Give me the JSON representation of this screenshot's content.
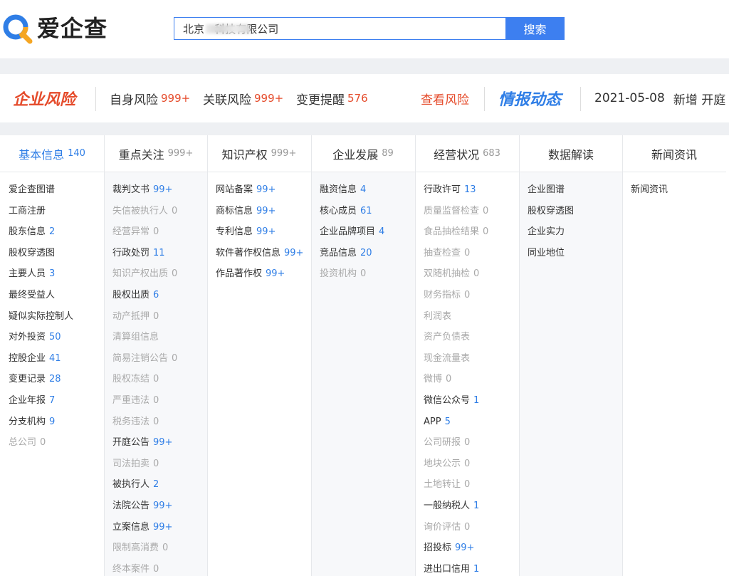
{
  "brand": {
    "name": "爱企查",
    "logo_icon": "magnifier-logo-icon",
    "colors": {
      "blue": "#2f7ee6",
      "orange": "#f5a623"
    }
  },
  "search": {
    "value": "北京   科技有限公司",
    "button_label": "搜索"
  },
  "risk_bar": {
    "banner": "企业风险",
    "items": [
      {
        "label": "自身风险",
        "count": "999+"
      },
      {
        "label": "关联风险",
        "count": "999+"
      },
      {
        "label": "变更提醒",
        "count": "576"
      }
    ],
    "check_label": "查看风险",
    "dynamic_banner": "情报动态",
    "dynamic_date": "2021-05-08",
    "dynamic_text": "新增 开庭"
  },
  "columns": [
    {
      "title": "基本信息",
      "count": "140",
      "items": [
        {
          "label": "爱企查图谱",
          "count": ""
        },
        {
          "label": "工商注册",
          "count": ""
        },
        {
          "label": "股东信息",
          "count": "2"
        },
        {
          "label": "股权穿透图",
          "count": ""
        },
        {
          "label": "主要人员",
          "count": "3"
        },
        {
          "label": "最终受益人",
          "count": ""
        },
        {
          "label": "疑似实际控制人",
          "count": ""
        },
        {
          "label": "对外投资",
          "count": "50"
        },
        {
          "label": "控股企业",
          "count": "41"
        },
        {
          "label": "变更记录",
          "count": "28"
        },
        {
          "label": "企业年报",
          "count": "7"
        },
        {
          "label": "分支机构",
          "count": "9"
        },
        {
          "label": "总公司",
          "count": "0"
        }
      ]
    },
    {
      "title": "重点关注",
      "count": "999+",
      "items": [
        {
          "label": "裁判文书",
          "count": "99+"
        },
        {
          "label": "失信被执行人",
          "count": "0"
        },
        {
          "label": "经营异常",
          "count": "0"
        },
        {
          "label": "行政处罚",
          "count": "11"
        },
        {
          "label": "知识产权出质",
          "count": "0"
        },
        {
          "label": "股权出质",
          "count": "6"
        },
        {
          "label": "动产抵押",
          "count": "0"
        },
        {
          "label": "清算组信息",
          "count": ""
        },
        {
          "label": "简易注销公告",
          "count": "0"
        },
        {
          "label": "股权冻结",
          "count": "0"
        },
        {
          "label": "严重违法",
          "count": "0"
        },
        {
          "label": "税务违法",
          "count": "0"
        },
        {
          "label": "开庭公告",
          "count": "99+"
        },
        {
          "label": "司法拍卖",
          "count": "0"
        },
        {
          "label": "被执行人",
          "count": "2"
        },
        {
          "label": "法院公告",
          "count": "99+"
        },
        {
          "label": "立案信息",
          "count": "99+"
        },
        {
          "label": "限制高消费",
          "count": "0"
        },
        {
          "label": "终本案件",
          "count": "0"
        }
      ]
    },
    {
      "title": "知识产权",
      "count": "999+",
      "items": [
        {
          "label": "网站备案",
          "count": "99+"
        },
        {
          "label": "商标信息",
          "count": "99+"
        },
        {
          "label": "专利信息",
          "count": "99+"
        },
        {
          "label": "软件著作权信息",
          "count": "99+"
        },
        {
          "label": "作品著作权",
          "count": "99+"
        }
      ]
    },
    {
      "title": "企业发展",
      "count": "89",
      "items": [
        {
          "label": "融资信息",
          "count": "4"
        },
        {
          "label": "核心成员",
          "count": "61"
        },
        {
          "label": "企业品牌项目",
          "count": "4"
        },
        {
          "label": "竞品信息",
          "count": "20"
        },
        {
          "label": "投资机构",
          "count": "0"
        }
      ]
    },
    {
      "title": "经营状况",
      "count": "683",
      "items": [
        {
          "label": "行政许可",
          "count": "13"
        },
        {
          "label": "质量监督检查",
          "count": "0"
        },
        {
          "label": "食品抽检结果",
          "count": "0"
        },
        {
          "label": "抽查检查",
          "count": "0"
        },
        {
          "label": "双随机抽检",
          "count": "0"
        },
        {
          "label": "财务指标",
          "count": "0"
        },
        {
          "label": "利润表",
          "count": ""
        },
        {
          "label": "资产负债表",
          "count": ""
        },
        {
          "label": "现金流量表",
          "count": ""
        },
        {
          "label": "微博",
          "count": "0"
        },
        {
          "label": "微信公众号",
          "count": "1"
        },
        {
          "label": "APP",
          "count": "5"
        },
        {
          "label": "公司研报",
          "count": "0"
        },
        {
          "label": "地块公示",
          "count": "0"
        },
        {
          "label": "土地转让",
          "count": "0"
        },
        {
          "label": "一般纳税人",
          "count": "1"
        },
        {
          "label": "询价评估",
          "count": "0"
        },
        {
          "label": "招投标",
          "count": "99+"
        },
        {
          "label": "进出口信用",
          "count": "1"
        }
      ]
    },
    {
      "title": "数据解读",
      "count": "",
      "items": [
        {
          "label": "企业图谱",
          "count": ""
        },
        {
          "label": "股权穿透图",
          "count": ""
        },
        {
          "label": "企业实力",
          "count": ""
        },
        {
          "label": "同业地位",
          "count": ""
        }
      ]
    },
    {
      "title": "新闻资讯",
      "count": "",
      "items": [
        {
          "label": "新闻资讯",
          "count": ""
        }
      ]
    }
  ],
  "zero_items": [
    "失信被执行人",
    "经营异常",
    "知识产权出质",
    "动产抵押",
    "清算组信息",
    "简易注销公告",
    "股权冻结",
    "严重违法",
    "税务违法",
    "司法拍卖",
    "限制高消费",
    "终本案件",
    "总公司",
    "投资机构",
    "质量监督检查",
    "食品抽检结果",
    "抽查检查",
    "双随机抽检",
    "财务指标",
    "利润表",
    "资产负债表",
    "现金流量表",
    "微博",
    "公司研报",
    "地块公示",
    "土地转让",
    "询价评估"
  ]
}
